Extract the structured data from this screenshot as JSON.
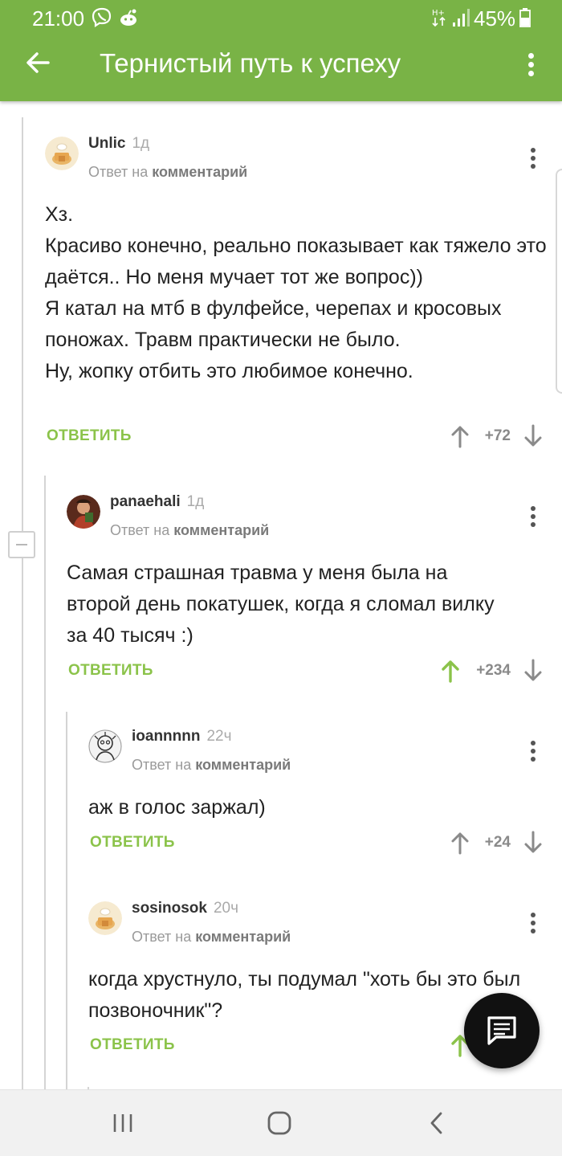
{
  "colors": {
    "accent": "#79b346",
    "reply": "#8bc34a",
    "upvoted": "#8bc34a"
  },
  "status_bar": {
    "time": "21:00",
    "battery": "45%",
    "icons": [
      "viber-icon",
      "reddit-icon",
      "data-arrows-icon",
      "signal-icon",
      "battery-icon"
    ]
  },
  "app_bar": {
    "title": "Тернистый путь к успеху",
    "back_icon": "arrow-left-icon",
    "menu_icon": "more-vert-icon"
  },
  "comments": [
    {
      "username": "Unlic",
      "age": "1д",
      "reply_prefix": "Ответ на",
      "reply_target": "комментарий",
      "text": "Хз.\nКрасиво конечно, реально показывает как тяжело это даётся.. Но меня мучает тот же вопрос))\nЯ катал на мтб в фулфейсе, черепах и кросовых поножах. Травм практически не было.\nНу, жопку отбить это любимое конечно.",
      "reply_label": "ОТВЕТИТЬ",
      "rating": "+72",
      "upvoted": false
    },
    {
      "username": "panaehali",
      "age": "1д",
      "reply_prefix": "Ответ на",
      "reply_target": "комментарий",
      "text": "Самая страшная травма у меня была на второй день покатушек, когда я сломал вилку за 40 тысяч :)",
      "reply_label": "ОТВЕТИТЬ",
      "rating": "+234",
      "upvoted": true
    },
    {
      "username": "ioannnnn",
      "age": "22ч",
      "reply_prefix": "Ответ на",
      "reply_target": "комментарий",
      "text": "аж в голос заржал)",
      "reply_label": "ОТВЕТИТЬ",
      "rating": "+24",
      "upvoted": false
    },
    {
      "username": "sosinosok",
      "age": "20ч",
      "reply_prefix": "Ответ на",
      "reply_target": "комментарий",
      "text": "когда хрустнуло, ты подумал \"хоть бы это был позвоночник\"?",
      "reply_label": "ОТВЕТИТЬ",
      "rating": "",
      "upvoted": true
    }
  ],
  "fab": {
    "icon": "comment-icon"
  },
  "nav_bar": {
    "icons": [
      "recent-apps-icon",
      "home-icon",
      "back-icon"
    ]
  }
}
